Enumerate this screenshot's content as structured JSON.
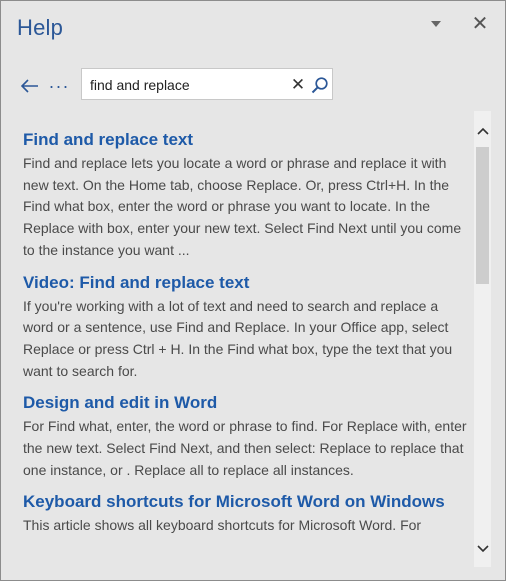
{
  "pane": {
    "title": "Help"
  },
  "header": {
    "options_icon": "chevron-down-icon",
    "close_icon": "close-icon",
    "close_glyph": "✕"
  },
  "toolbar": {
    "back_icon": "back-arrow-icon",
    "more_glyph": "···"
  },
  "search": {
    "value": "find and replace",
    "clear_glyph": "✕",
    "search_icon": "search-icon"
  },
  "results": [
    {
      "title": "Find and replace text",
      "snippet": "Find and replace lets you locate a word or phrase and replace it with new text. On the Home tab, choose Replace. Or, press Ctrl+H. In the Find what box, enter the word or phrase you want to locate. In the Replace with box, enter your new text. Select Find Next until you come to the instance you want ..."
    },
    {
      "title": "Video: Find and replace text",
      "snippet": "If you're working with a lot of text and need to search and replace a word or a sentence, use Find and Replace. In your Office app, select Replace or press Ctrl + H. In the Find what box, type the text that you want to search for."
    },
    {
      "title": "Design and edit in Word",
      "snippet": "For Find what, enter, the word or phrase to find. For Replace with, enter the new text. Select Find Next, and then select: Replace to replace that one instance, or . Replace all to replace all instances."
    },
    {
      "title": "Keyboard shortcuts for Microsoft Word on Windows",
      "snippet": "This article shows all keyboard shortcuts for Microsoft Word. For"
    }
  ],
  "colors": {
    "background": "#e6e6e6",
    "link": "#1e5aa8",
    "title": "#2b5797"
  }
}
